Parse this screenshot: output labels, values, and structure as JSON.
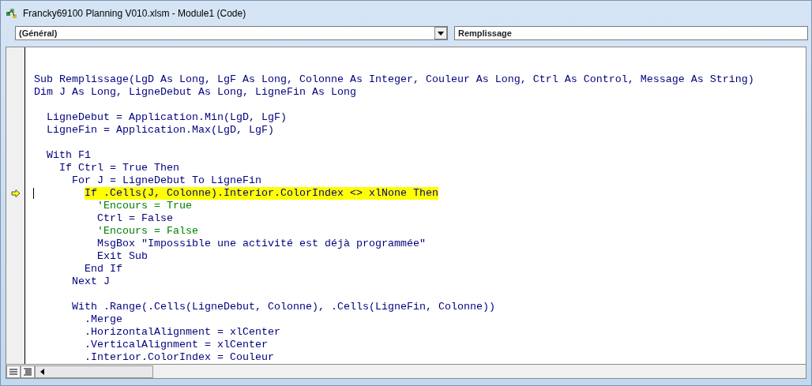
{
  "window": {
    "title": "Francky69100 Planning V010.xlsm - Module1 (Code)"
  },
  "object_dropdown": {
    "value": "(Général)"
  },
  "procedure_dropdown": {
    "value": "Remplissage"
  },
  "code_lines": [
    {
      "kind": "blank"
    },
    {
      "kind": "blank"
    },
    {
      "kind": "code",
      "text": "Sub Remplissage(LgD As Long, LgF As Long, Colonne As Integer, Couleur As Long, Ctrl As Control, Message As String)",
      "highlighted": false,
      "cursor": false
    },
    {
      "kind": "code",
      "text": "Dim J As Long, LigneDebut As Long, LigneFin As Long",
      "highlighted": false,
      "cursor": false
    },
    {
      "kind": "blank"
    },
    {
      "kind": "code",
      "text": "  LigneDebut = Application.Min(LgD, LgF)",
      "highlighted": false,
      "cursor": false
    },
    {
      "kind": "code",
      "text": "  LigneFin = Application.Max(LgD, LgF)",
      "highlighted": false,
      "cursor": false
    },
    {
      "kind": "blank"
    },
    {
      "kind": "code",
      "text": "  With F1",
      "highlighted": false,
      "cursor": false
    },
    {
      "kind": "code",
      "text": "    If Ctrl = True Then",
      "highlighted": false,
      "cursor": false
    },
    {
      "kind": "code",
      "text": "      For J = LigneDebut To LigneFin",
      "highlighted": false,
      "cursor": false
    },
    {
      "kind": "code",
      "text": "        If .Cells(J, Colonne).Interior.ColorIndex <> xlNone Then",
      "highlighted": true,
      "cursor": true
    },
    {
      "kind": "comment",
      "text": "          'Encours = True",
      "highlighted": false,
      "cursor": false
    },
    {
      "kind": "code",
      "text": "          Ctrl = False",
      "highlighted": false,
      "cursor": false
    },
    {
      "kind": "comment",
      "text": "          'Encours = False",
      "highlighted": false,
      "cursor": false
    },
    {
      "kind": "code",
      "text": "          MsgBox \"Impossible une activité est déjà programmée\"",
      "highlighted": false,
      "cursor": false
    },
    {
      "kind": "code",
      "text": "          Exit Sub",
      "highlighted": false,
      "cursor": false
    },
    {
      "kind": "code",
      "text": "        End If",
      "highlighted": false,
      "cursor": false
    },
    {
      "kind": "code",
      "text": "      Next J",
      "highlighted": false,
      "cursor": false
    },
    {
      "kind": "blank"
    },
    {
      "kind": "code",
      "text": "      With .Range(.Cells(LigneDebut, Colonne), .Cells(LigneFin, Colonne))",
      "highlighted": false,
      "cursor": false
    },
    {
      "kind": "code",
      "text": "        .Merge",
      "highlighted": false,
      "cursor": false
    },
    {
      "kind": "code",
      "text": "        .HorizontalAlignment = xlCenter",
      "highlighted": false,
      "cursor": false
    },
    {
      "kind": "code",
      "text": "        .VerticalAlignment = xlCenter",
      "highlighted": false,
      "cursor": false
    },
    {
      "kind": "code",
      "text": "        .Interior.ColorIndex = Couleur",
      "highlighted": false,
      "cursor": false
    }
  ]
}
